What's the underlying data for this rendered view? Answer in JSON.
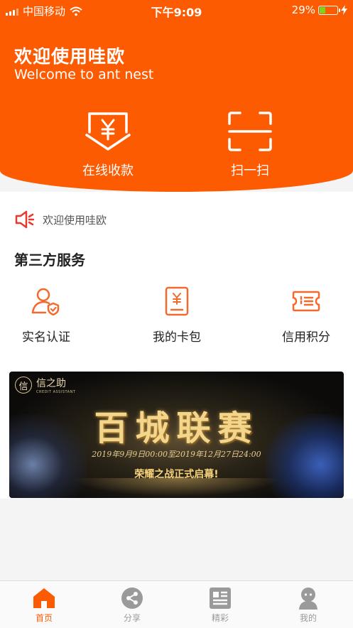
{
  "status_bar": {
    "carrier": "中国移动",
    "time": "下午9:09",
    "battery": "29%",
    "battery_level": 0.29
  },
  "header": {
    "title": "欢迎使用哇欧",
    "subtitle": "Welcome to ant nest",
    "actions": [
      {
        "label": "在线收款",
        "icon": "receive-payment-icon"
      },
      {
        "label": "扫一扫",
        "icon": "scan-icon"
      }
    ]
  },
  "notice": {
    "text": "欢迎使用哇欧",
    "icon": "speaker-icon"
  },
  "services": {
    "title": "第三方服务",
    "items": [
      {
        "label": "实名认证",
        "icon": "id-verify-icon"
      },
      {
        "label": "我的卡包",
        "icon": "card-wallet-icon"
      },
      {
        "label": "信用积分",
        "icon": "credit-points-icon"
      }
    ]
  },
  "banner": {
    "brand": "信之助",
    "brand_sub": "CREDIT ASSISTANT",
    "title": "百城联赛",
    "date": "2019年9月9日00:00至2019年12月27日24:00",
    "slogan": "荣耀之战正式启幕!"
  },
  "tabbar": {
    "items": [
      {
        "label": "首页",
        "icon": "home-icon",
        "active": true
      },
      {
        "label": "分享",
        "icon": "share-icon",
        "active": false
      },
      {
        "label": "精彩",
        "icon": "news-icon",
        "active": false
      },
      {
        "label": "我的",
        "icon": "profile-icon",
        "active": false
      }
    ]
  },
  "colors": {
    "accent": "#fd5b02",
    "icon_orange": "#f46a2d",
    "inactive": "#9a9a9a",
    "battery_fill": "#7ed321"
  }
}
